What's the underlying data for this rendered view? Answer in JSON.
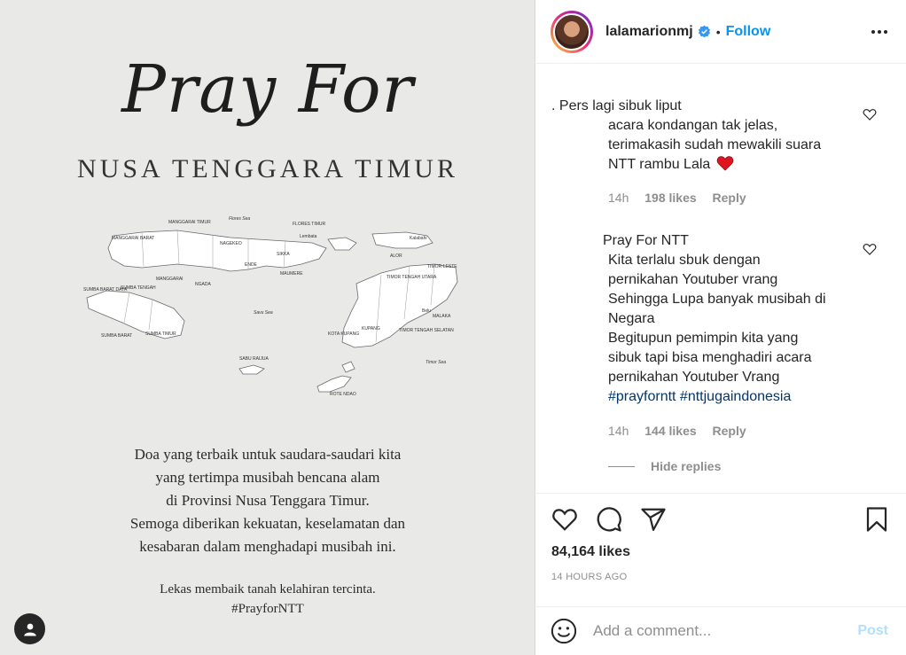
{
  "image": {
    "title_script": "Pray For",
    "title_sub": "NUSA TENGGARA TIMUR",
    "caption_lines": [
      "Doa yang terbaik untuk saudara-saudari kita",
      "yang tertimpa musibah bencana alam",
      "di Provinsi Nusa Tenggara Timur.",
      "Semoga diberikan kekuatan, keselamatan dan",
      "kesabaran dalam menghadapi musibah ini."
    ],
    "footer_lines": [
      "Lekas membaik tanah kelahiran tercinta.",
      "#PrayforNTT"
    ],
    "map_labels": {
      "flores_sea": "Flores Sea",
      "manggarai_timur": "MANGGARAI TIMUR",
      "manggarai_barat": "MANGGARAI BARAT",
      "flores_timur": "FLORES TIMUR",
      "lembata": "Lembata",
      "nagekeo": "NAGEKEO",
      "sikka": "SIKKA",
      "alor": "ALOR",
      "kalabahi": "Kalabahi",
      "ende": "ENDE",
      "maumere": "MAUMERE",
      "manggarai": "MANGGARAI",
      "ngada": "NGADA",
      "sumba_barat_daya": "SUMBA BARAT DAYA",
      "sumba_tengah": "SUMBA TENGAH",
      "sumba_barat": "SUMBA BARAT",
      "sumba_timur": "SUMBA TIMUR",
      "savu_sea": "Savu Sea",
      "timor_tengah_utara": "TIMOR TENGAH UTARA",
      "timor_leste": "TIMOR-LESTE",
      "kota_kupang": "KOTA KUPANG",
      "kupang": "KUPANG",
      "timor_tengah_selatan": "TIMOR TENGAH SELATAN",
      "belu": "Belu",
      "malaka": "MALAKA",
      "sabu_raijua": "SABU RAIJUA",
      "timor_sea": "Timor Sea",
      "rote_ndao": "ROTE NDAO"
    }
  },
  "header": {
    "username": "lalamarionmj",
    "separator": "•",
    "follow_label": "Follow"
  },
  "comments": [
    {
      "name_masked": "              ",
      "text_lines": [
        ". Pers lagi sibuk liput",
        "acara kondangan tak jelas,",
        "terimakasih sudah mewakili suara",
        "NTT rambu Lala"
      ],
      "time": "14h",
      "likes": "198 likes",
      "reply_label": "Reply"
    },
    {
      "name_masked": "              ",
      "text_lines": [
        " Pray For NTT",
        "Kita terlalu sbuk dengan",
        "pernikahan Youtuber vrang",
        "Sehingga Lupa banyak musibah di",
        "Negara",
        "Begitupun pemimpin kita yang",
        "sibuk tapi bisa menghadiri acara",
        "pernikahan Youtuber Vrang"
      ],
      "hashtags": "#prayforntt #nttjugaindonesia",
      "time": "14h",
      "likes": "144 likes",
      "reply_label": "Reply"
    }
  ],
  "hide_replies_label": "Hide replies",
  "actions": {
    "likes": "84,164 likes",
    "timestamp": "14 HOURS AGO"
  },
  "comment_bar": {
    "placeholder": "Add a comment...",
    "post_label": "Post"
  },
  "colors": {
    "accent": "#0095f6",
    "verified": "#3897f0",
    "heart": "#ed4956",
    "muted": "#8e8e8e"
  },
  "icons": [
    "verified-badge-icon",
    "more-options-icon",
    "heart-icon",
    "comment-icon",
    "share-icon",
    "bookmark-icon",
    "emoji-icon",
    "user-tag-icon"
  ]
}
